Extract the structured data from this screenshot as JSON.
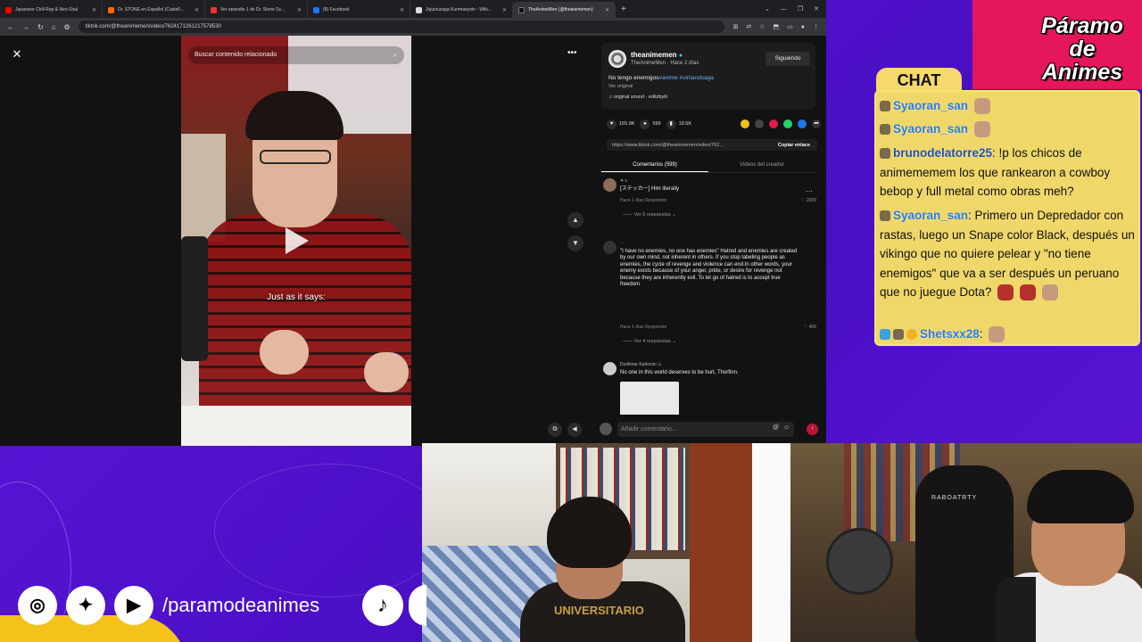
{
  "browser": {
    "tabs": [
      {
        "title": "Japanese Chill Rap & Neo-Soul",
        "color": "#ff0000"
      },
      {
        "title": "Dr. STONE en Español (Castell...",
        "color": "#ff6a00"
      },
      {
        "title": "Ver episodio 1 de Dr. Stone Sc...",
        "color": "#e33"
      },
      {
        "title": "(8) Facebook",
        "color": "#1877f2"
      },
      {
        "title": "Jujutsusaga Kurimaeyoin - Wiki...",
        "color": "#ddd"
      },
      {
        "title": "TheAnimeMen (@theanimemen)",
        "color": "#111"
      }
    ],
    "url": "tiktok.com/@theanimemen/video/7624171261217578530"
  },
  "tiktok": {
    "search_placeholder": "Buscar contenido relacionado",
    "subtitle": "Just as it says:",
    "author": {
      "name": "theanimemen",
      "sub": "TheAnimeMen · Hace 2 días",
      "follow_label": "Siguiendo"
    },
    "caption_text": "No tengo enemigos",
    "caption_tags": "#anime #vinlandsaga",
    "ver_original": "Ver original",
    "sound": "♫ original sound - editzbyili",
    "stats": {
      "likes": "165.9K",
      "comments": "599",
      "saves": "19.5K"
    },
    "link": {
      "url": "https://www.tiktok.com/@theanimemen/video/762...",
      "copy_label": "Copiar enlace"
    },
    "tabs": {
      "comments": "Comentarios (599)",
      "creator": "Videos del creador"
    },
    "comments": [
      {
        "user": "✦ ε",
        "body": "[ステッカー] Him literally",
        "meta": "Hace 1 días   Responder",
        "likes": "♡ 2039",
        "replies": "—— Ver 5 respuestas ⌄"
      },
      {
        "user": "· · ·",
        "body": "\"I have no enemies, no one has enemies\" Hatred and enemies are created by our own mind, not inherent in others. If you stop labeling people as enemies, the cycle of revenge and violence can end.In other words, your enemy exists because of your anger, pride, or desire for revenge not because they are inherently evil. To let go of hatred is to accept true freedom",
        "meta": "Hace 1 días   Responder",
        "likes": "♡ 466",
        "replies": "—— Ver 4 respuestas ⌄"
      },
      {
        "user": "Dorilimar Karlovini ⚠",
        "body": "No one in this world deserves to be hurt, Thorfinn."
      }
    ],
    "comment_placeholder": "Añadir comentario..."
  },
  "overlay": {
    "logo_lines": [
      "Páramo",
      "de",
      "Animes"
    ],
    "chat_label": "CHAT",
    "social_handle": "/paramodeanimes",
    "brand_colors": {
      "purple": "#5d17dd",
      "pink": "#e5165b",
      "yellow": "#f4c21a",
      "chat_bg": "#efd76a"
    },
    "camera1_shirt": "UNIVERSITARIO",
    "camera2_chair": "RABOATRTY"
  },
  "chat": [
    {
      "user": "Syaoran_san",
      "text": ""
    },
    {
      "user": "Syaoran_san",
      "text": ""
    },
    {
      "user": "brunodelatorre25",
      "text": ": !p los chicos de animememem los que rankearon a cowboy bebop y full metal como obras meh?"
    },
    {
      "user": "Syaoran_san",
      "text": ": Primero un Depredador con rastas, luego un Snape color Black, después un vikingo que no quiere pelear y \"no tiene enemigos\" que va a ser después un peruano que no juegue Dota?"
    },
    {
      "user": "Shetsxx28",
      "text": ":"
    }
  ]
}
